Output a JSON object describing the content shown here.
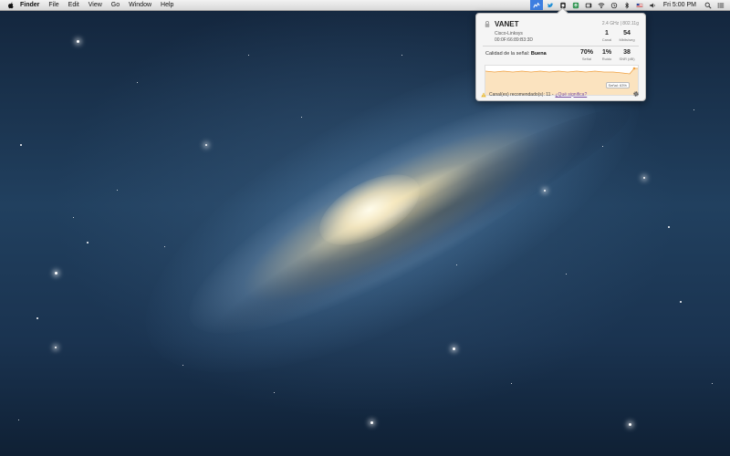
{
  "menubar": {
    "app_name": "Finder",
    "menus": [
      "File",
      "Edit",
      "View",
      "Go",
      "Window",
      "Help"
    ],
    "clock": "Fri 5:00 PM",
    "status_icons": [
      "wifi-explorer-icon",
      "twitter-icon",
      "evernote-icon",
      "sync-icon",
      "battery-meter-icon",
      "wifi-icon",
      "time-machine-icon",
      "bluetooth-icon",
      "flag-icon",
      "volume-icon"
    ]
  },
  "wifi_popover": {
    "network_name": "VANET",
    "frequency": "2.4 GHz | 802.11g",
    "vendor": "Cisco-Linksys",
    "bssid": "00:0F:66:89:B3:3D",
    "channel_value": "1",
    "channel_label": "Canal",
    "rate_value": "54",
    "rate_label": "Mbits/seg",
    "quality_label": "Calidad de la señal:",
    "quality_value": "Buena",
    "signal_value": "70%",
    "signal_label": "Señal",
    "noise_value": "1%",
    "noise_label": "Ruido",
    "snr_value": "38",
    "snr_label": "SNR (dB)",
    "graph_tooltip": "Señal: 63%",
    "graph_color": "#f0a040",
    "recommended_text": "Canal(es) recomendado(s): 11 -",
    "recommended_link": "¿Qué significa?"
  }
}
